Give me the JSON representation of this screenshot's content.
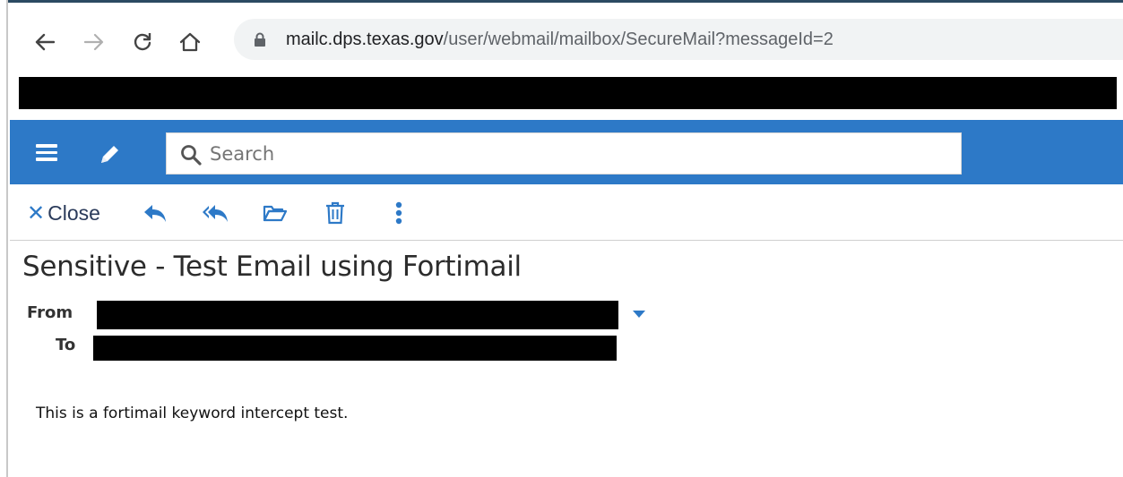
{
  "browser": {
    "url_host": "mailc.dps.texas.gov",
    "url_path": "/user/webmail/mailbox/SecureMail?messageId=2"
  },
  "header": {
    "search_placeholder": "Search",
    "accent_color": "#2d79c7"
  },
  "toolbar": {
    "close_label": "Close",
    "icons": [
      "reply-icon",
      "reply-all-icon",
      "folder-icon",
      "trash-icon",
      "more-vertical-icon"
    ]
  },
  "message": {
    "subject": "Sensitive - Test Email using Fortimail",
    "from_label": "From",
    "to_label": "To",
    "body": "This is a fortimail keyword intercept test."
  }
}
